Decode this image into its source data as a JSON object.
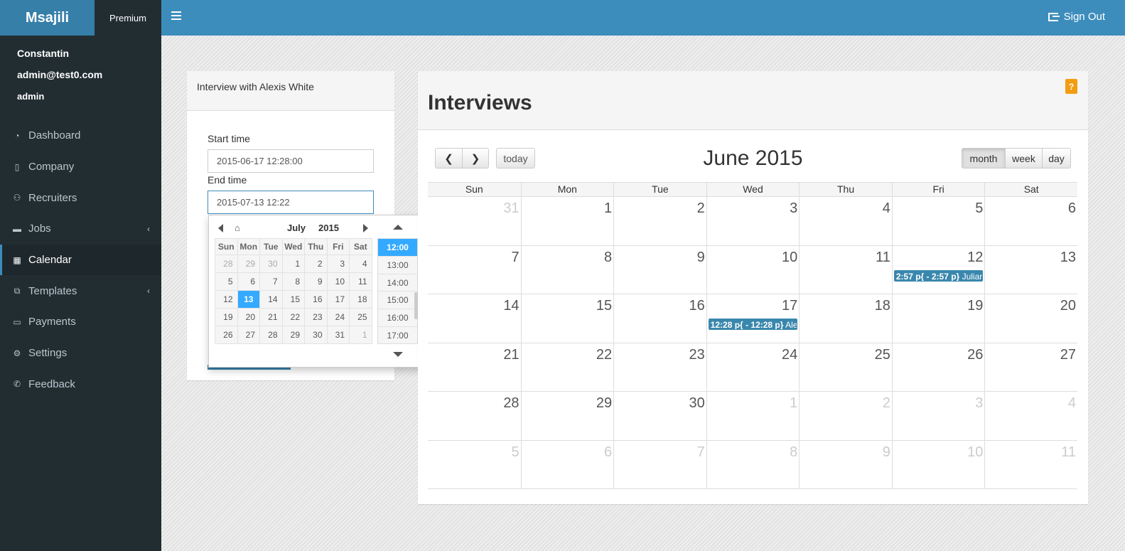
{
  "brand": {
    "logo": "Msajili",
    "plan": "Premium"
  },
  "header": {
    "sign_out": "Sign Out"
  },
  "user": {
    "name": "Constantin",
    "email": "admin@test0.com",
    "role": "admin"
  },
  "sidebar": {
    "items": [
      {
        "label": "Dashboard",
        "icon": "dashboard-icon",
        "glyph": "◔"
      },
      {
        "label": "Company",
        "icon": "building-icon",
        "glyph": "▯"
      },
      {
        "label": "Recruiters",
        "icon": "users-icon",
        "glyph": "⚇"
      },
      {
        "label": "Jobs",
        "icon": "briefcase-icon",
        "glyph": "▬",
        "caret": "‹"
      },
      {
        "label": "Calendar",
        "icon": "calendar-icon",
        "glyph": "▦"
      },
      {
        "label": "Templates",
        "icon": "copy-icon",
        "glyph": "⧉",
        "caret": "‹"
      },
      {
        "label": "Payments",
        "icon": "credit-card-icon",
        "glyph": "▭"
      },
      {
        "label": "Settings",
        "icon": "gears-icon",
        "glyph": "⚙"
      },
      {
        "label": "Feedback",
        "icon": "phone-icon",
        "glyph": "✆"
      }
    ],
    "active_index": 4
  },
  "form": {
    "title": "Interview with Alexis White",
    "start_label": "Start time",
    "start_value": "2015-06-17 12:28:00",
    "end_label": "End time",
    "end_value": "2015-07-13 12:22"
  },
  "datepicker": {
    "month": "July",
    "year": "2015",
    "weekdays": [
      "Sun",
      "Mon",
      "Tue",
      "Wed",
      "Thu",
      "Fri",
      "Sat"
    ],
    "weeks": [
      [
        "28",
        "29",
        "30",
        "1",
        "2",
        "3",
        "4"
      ],
      [
        "5",
        "6",
        "7",
        "8",
        "9",
        "10",
        "11"
      ],
      [
        "12",
        "13",
        "14",
        "15",
        "16",
        "17",
        "18"
      ],
      [
        "19",
        "20",
        "21",
        "22",
        "23",
        "24",
        "25"
      ],
      [
        "26",
        "27",
        "28",
        "29",
        "30",
        "31",
        "1"
      ]
    ],
    "selected_day": "13",
    "times": [
      "12:00",
      "13:00",
      "14:00",
      "15:00",
      "16:00",
      "17:00"
    ],
    "selected_time": "12:00"
  },
  "calendar": {
    "title": "Interviews",
    "help": "?",
    "month_label": "June 2015",
    "today_label": "today",
    "views": [
      "month",
      "week",
      "day"
    ],
    "active_view": "month",
    "weekdays": [
      "Sun",
      "Mon",
      "Tue",
      "Wed",
      "Thu",
      "Fri",
      "Sat"
    ],
    "weeks": [
      [
        "31",
        "1",
        "2",
        "3",
        "4",
        "5",
        "6"
      ],
      [
        "7",
        "8",
        "9",
        "10",
        "11",
        "12",
        "13"
      ],
      [
        "14",
        "15",
        "16",
        "17",
        "18",
        "19",
        "20"
      ],
      [
        "21",
        "22",
        "23",
        "24",
        "25",
        "26",
        "27"
      ],
      [
        "28",
        "29",
        "30",
        "1",
        "2",
        "3",
        "4"
      ],
      [
        "5",
        "6",
        "7",
        "8",
        "9",
        "10",
        "11"
      ]
    ],
    "events": [
      {
        "week": 1,
        "day": 5,
        "time": "2:57 p{ - 2:57 p}",
        "title": "Julian"
      },
      {
        "week": 2,
        "day": 3,
        "time": "12:28 p{ - 12:28 p}",
        "title": "Alexis White"
      }
    ]
  }
}
